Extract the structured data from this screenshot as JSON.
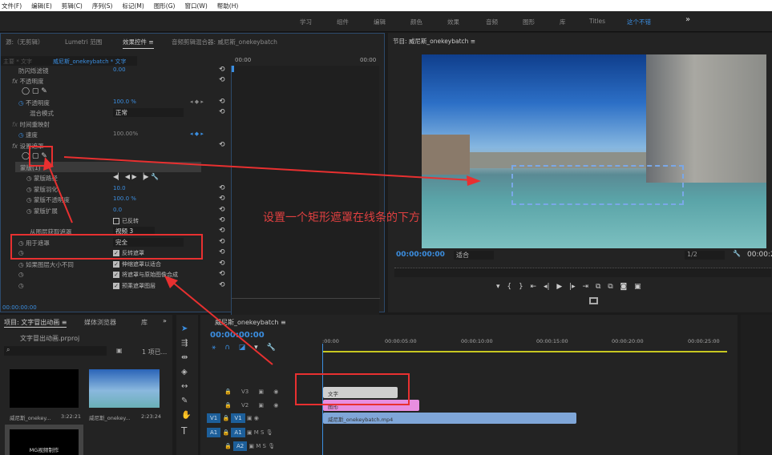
{
  "menu": [
    "文件(F)",
    "编辑(E)",
    "剪辑(C)",
    "序列(S)",
    "标记(M)",
    "图形(G)",
    "窗口(W)",
    "帮助(H)"
  ],
  "workspaces": [
    "学习",
    "组件",
    "编辑",
    "颜色",
    "效果",
    "音频",
    "图形",
    "库",
    "Titles",
    "这个不错"
  ],
  "workspace_active": "这个不错",
  "overflow": "»",
  "effect_controls": {
    "tabs": [
      "源:（无剪辑）",
      "Lumetri 范围",
      "效果控件 ≡",
      "音频剪辑混合器: 威尼斯_onekeybatch"
    ],
    "clip_path": "主要 * 文字",
    "clip_name": "威尼斯_onekeybatch * 文字",
    "time_start": "00:00",
    "time_end": "00:00",
    "rows": [
      {
        "label": "防闪烁滤镜",
        "value": "0.00"
      },
      {
        "label": "不透明度"
      },
      {
        "label": "不透明度",
        "value": "100.0 %"
      },
      {
        "label": "混合模式",
        "value": "正常"
      },
      {
        "label": "时间重映射"
      },
      {
        "label": "速度",
        "value": "100.00%"
      },
      {
        "label": "设置遮罩"
      },
      {
        "label": "蒙版(1)"
      },
      {
        "label": "蒙版路径"
      },
      {
        "label": "蒙版羽化",
        "value": "10.0"
      },
      {
        "label": "蒙版不透明度",
        "value": "100.0 %"
      },
      {
        "label": "蒙版扩展",
        "value": "0.0"
      },
      {
        "label": "",
        "value": "已反转"
      },
      {
        "label": "从图层获取遮罩",
        "value": "视频 3"
      },
      {
        "label": "用于遮罩",
        "value": "完全"
      },
      {
        "label": "",
        "value": "反转遮罩"
      },
      {
        "label": "如果图层大小不同",
        "value": "伸缩遮罩以适合"
      },
      {
        "label": "",
        "value": "将遮罩与原始图像合成"
      },
      {
        "label": "",
        "value": "预乘遮罩图层"
      }
    ],
    "timecode": "00:00:00:00"
  },
  "program": {
    "title": "节目: 威尼斯_onekeybatch ≡",
    "timecode": "00:00:00:00",
    "fit": "适合",
    "resolution": "1/2",
    "duration": "00:00:2",
    "annotation": "设置一个矩形遮罩在线条的下方"
  },
  "project": {
    "tabs": [
      "项目: 文字冒出动画 ≡",
      "媒体浏览器",
      "库",
      "»"
    ],
    "file": "文字冒出动画.prproj",
    "count": "1 项已...",
    "items": [
      {
        "name": "威尼斯_onekey...",
        "duration": "3:22:21"
      },
      {
        "name": "威尼斯_onekey...",
        "duration": "2:23:24"
      },
      {
        "name": "MG视频制作"
      }
    ]
  },
  "timeline": {
    "title": "威尼斯_onekeybatch ≡",
    "timecode": "00:00:00:00",
    "ruler": [
      ":00:00",
      "00:00:05:00",
      "00:00:10:00",
      "00:00:15:00",
      "00:00:20:00",
      "00:00:25:00"
    ],
    "tracks": [
      "V3",
      "V2",
      "V1",
      "A1",
      "A2"
    ],
    "clips": [
      {
        "name": "文字",
        "color": "#cfcfcf"
      },
      {
        "name": "图形",
        "color": "#e88ee0"
      },
      {
        "name": "威尼斯_onekeybatch.mp4",
        "color": "#7fa6d8"
      }
    ]
  }
}
